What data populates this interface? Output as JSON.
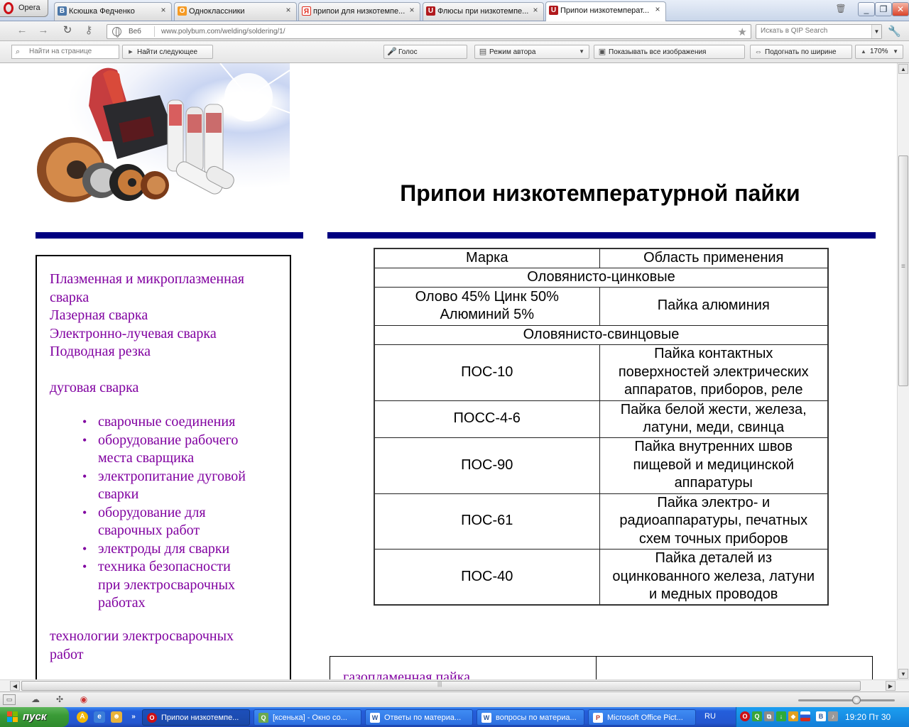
{
  "browser": {
    "menu_label": "Opera",
    "tabs": [
      {
        "label": "Ксюшка Федченко",
        "icon": "В",
        "color": "#4a76a8"
      },
      {
        "label": "Одноклассники",
        "icon": "О",
        "color": "#f59a23"
      },
      {
        "label": "припои для низкотемпе...",
        "icon": "Я",
        "color": "#e02a1a"
      },
      {
        "label": "Флюсы при низкотемпе...",
        "icon": "U",
        "color": "#b1191d"
      },
      {
        "label": "Припои низкотемперат...",
        "icon": "U",
        "color": "#b1191d"
      }
    ],
    "address": {
      "scheme": "Веб",
      "url": "www.polybum.com/welding/soldering/1/"
    },
    "search_placeholder": "Искать в QIP Search",
    "toolbar": {
      "find_placeholder": "Найти на странице",
      "find_next": "Найти следующее",
      "voice": "Голос",
      "author_mode": "Режим автора",
      "show_images": "Показывать все изображения",
      "fit_width": "Подогнать по ширине",
      "zoom": "170%"
    }
  },
  "page": {
    "title": "Припои низкотемпературной пайки",
    "menu": {
      "top": [
        "Плазменная и микроплазменная",
        "сварка",
        "Лазерная сварка",
        "Электронно-лучевая сварка",
        "Подводная резка"
      ],
      "arc": "дуговая сварка",
      "bullets": [
        [
          "сварочные соединения"
        ],
        [
          "оборудование рабочего",
          "места сварщика"
        ],
        [
          "электропитание дуговой",
          "сварки"
        ],
        [
          "оборудование для",
          "сварочных работ"
        ],
        [
          "электроды для сварки"
        ],
        [
          "техника безопасности",
          "при электросварочных",
          "работах"
        ]
      ],
      "tech": [
        "технологии электросварочных",
        "работ"
      ]
    },
    "table": {
      "headers": [
        "Марка",
        "Область применения"
      ],
      "group1": "Оловянисто-цинковые",
      "row1": {
        "brand": [
          "Олово 45% Цинк 50%",
          "Алюминий 5%"
        ],
        "use": [
          "Пайка алюминия"
        ]
      },
      "group2": "Оловянисто-свинцовые",
      "rows": [
        {
          "brand": "ПОС-10",
          "use": [
            "Пайка контактных",
            "поверхностей электрических",
            "аппаратов, приборов, реле"
          ]
        },
        {
          "brand": "ПОСС-4-6",
          "use": [
            "Пайка белой жести, железа,",
            "латуни, меди, свинца"
          ]
        },
        {
          "brand": "ПОС-90",
          "use": [
            "Пайка внутренних швов",
            "пищевой и медицинской",
            "аппаратуры"
          ]
        },
        {
          "brand": "ПОС-61",
          "use": [
            "Пайка электро- и",
            "радиоаппаратуры, печатных",
            "схем точных приборов"
          ]
        },
        {
          "brand": "ПОС-40",
          "use": [
            "Пайка деталей из",
            "оцинкованного железа, латуни",
            "и медных проводов"
          ]
        }
      ]
    },
    "bottom_link": "газопламенная пайка"
  },
  "taskbar": {
    "start": "пуск",
    "tasks": [
      {
        "label": "Припои низкотемпе...",
        "icon": "O",
        "color": "#cc0f16",
        "active": true
      },
      {
        "label": "[ксенька] - Окно со...",
        "icon": "Q",
        "color": "#6aa84f",
        "active": false
      },
      {
        "label": "Ответы по материа...",
        "icon": "W",
        "color": "#2b579a",
        "active": false
      },
      {
        "label": "вопросы по материа...",
        "icon": "W",
        "color": "#2b579a",
        "active": false
      },
      {
        "label": "Microsoft Office Pict...",
        "icon": "P",
        "color": "#c0392b",
        "active": false
      }
    ],
    "lang": "RU",
    "clock": "19:20 Пт 30"
  }
}
